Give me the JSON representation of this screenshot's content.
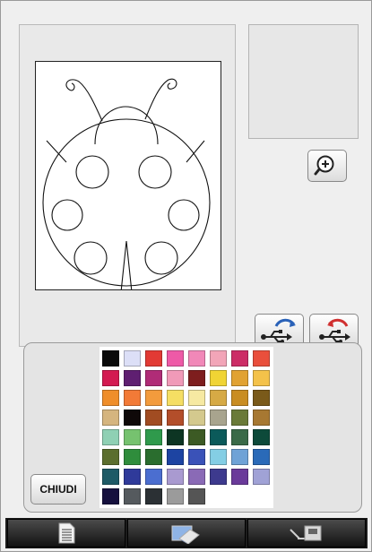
{
  "close_label": "CHIUDI",
  "palette": {
    "colors": [
      "#0a0a0a",
      "#dcdff7",
      "#e23a34",
      "#ee5aa7",
      "#f188b8",
      "#f2a5b8",
      "#cc2c66",
      "#e94f3c",
      "#d31a51",
      "#5f1f71",
      "#b02c77",
      "#f09ab8",
      "#7e1e1e",
      "#f0d434",
      "#e1a232",
      "#f4c24a",
      "#ef8e2a",
      "#f27a37",
      "#f39b3c",
      "#f5de63",
      "#f6e9a2",
      "#d6aa45",
      "#c98d22",
      "#7a5a1a",
      "#d5b57f",
      "#0f0909",
      "#a14c22",
      "#b34e2a",
      "#d4c98e",
      "#a8a48e",
      "#6a7a38",
      "#a77832",
      "#8fd0b4",
      "#76c26f",
      "#2f9a4c",
      "#0d3523",
      "#3c5a24",
      "#0b5a5a",
      "#3a6a48",
      "#0d4a3a",
      "#5b6e2e",
      "#2f8d3c",
      "#2a6d2e",
      "#1d44a2",
      "#3a52b8",
      "#84cee4",
      "#6fa2d6",
      "#2a6ab8",
      "#1e5a66",
      "#2f3a9a",
      "#4b6ed0",
      "#a99ad0",
      "#8a6ab6",
      "#3d3a8e",
      "#6a3a9a",
      "#a0a2d6",
      "#16113e",
      "#555a5e",
      "#2b3034",
      "#9b9b9b",
      "#555555"
    ]
  },
  "icons": {
    "zoom": "zoom-in-icon",
    "usb_save": "usb-save-icon",
    "usb_load": "usb-load-icon",
    "tab_1": "document-icon",
    "tab_2": "eraser-icon",
    "tab_3": "sewing-machine-icon"
  }
}
